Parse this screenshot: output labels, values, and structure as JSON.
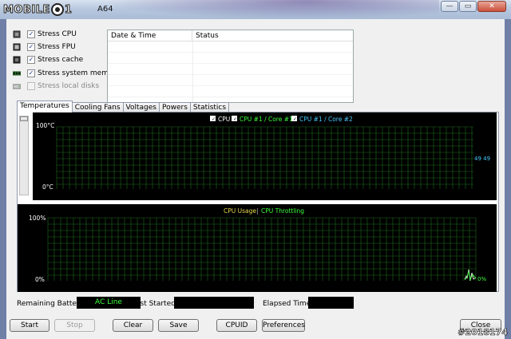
{
  "window": {
    "title": "A64",
    "logo_left": "MOBILE",
    "logo_right": "1",
    "controls": [
      "—",
      "▭",
      "✕"
    ]
  },
  "stress_options": [
    {
      "label": "Stress CPU",
      "checked": true,
      "icon": "cpu-icon"
    },
    {
      "label": "Stress FPU",
      "checked": true,
      "icon": "fpu-icon"
    },
    {
      "label": "Stress cache",
      "checked": true,
      "icon": "cache-icon"
    },
    {
      "label": "Stress system memory",
      "checked": true,
      "icon": "memory-icon"
    },
    {
      "label": "Stress local disks",
      "checked": false,
      "icon": "disk-icon"
    }
  ],
  "log_table": {
    "columns": [
      "Date & Time",
      "Status"
    ],
    "rows": []
  },
  "tabs": [
    "Temperatures",
    "Cooling Fans",
    "Voltages",
    "Powers",
    "Statistics"
  ],
  "active_tab": "Temperatures",
  "temperature_graph": {
    "legend": [
      {
        "label": "CPU",
        "color": "#ffffff",
        "checked": true
      },
      {
        "label": "CPU #1 / Core #1",
        "color": "#3cff3c",
        "checked": true
      },
      {
        "label": "CPU #1 / Core #2",
        "color": "#47c8ff",
        "checked": true
      }
    ],
    "y_max_label": "100°C",
    "y_min_label": "0°C",
    "value_label": "49 49",
    "grid_color": "#1e6b1e"
  },
  "usage_graph": {
    "legend_left": "CPU Usage",
    "legend_sep": "|",
    "legend_right": "CPU Throttling",
    "legend_left_color": "#e8d84a",
    "legend_right_color": "#3cff3c",
    "y_max_label": "100%",
    "y_min_label": "0%",
    "value_label": "0%"
  },
  "status": {
    "remaining_battery_label": "Remaining Battery:",
    "remaining_battery_value": "AC Line",
    "test_started_label": "Test Started:",
    "test_started_value": "",
    "elapsed_time_label": "Elapsed Time:",
    "elapsed_time_value": ""
  },
  "buttons": {
    "start": "Start",
    "stop": "Stop",
    "clear": "Clear",
    "save": "Save",
    "cpuid": "CPUID",
    "preferences": "Preferences",
    "close": "Close"
  },
  "watermark": "#2018174"
}
